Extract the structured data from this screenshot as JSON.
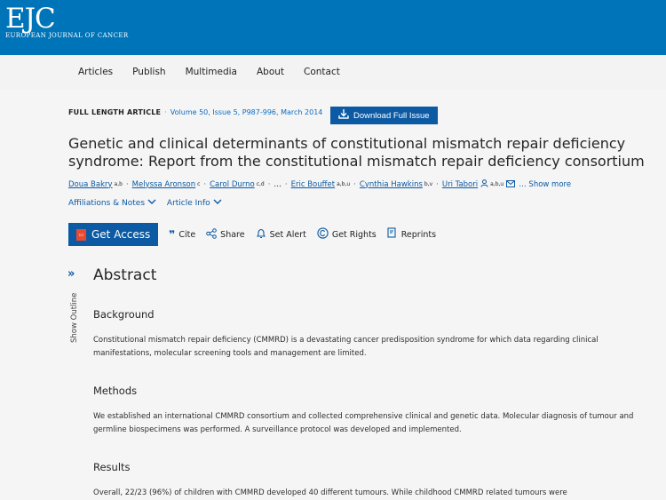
{
  "journal": {
    "logo_big": "EJC",
    "logo_small": "EUROPEAN JOURNAL OF CANCER"
  },
  "nav": {
    "items": [
      "Articles",
      "Publish",
      "Multimedia",
      "About",
      "Contact"
    ]
  },
  "article": {
    "type": "FULL LENGTH ARTICLE",
    "citation": "Volume 50, Issue 5, P987-996, March 2014",
    "download_label": "Download Full Issue",
    "title": "Genetic and clinical determinants of constitutional mismatch repair deficiency syndrome: Report from the constitutional mismatch repair deficiency consortium",
    "authors": [
      {
        "name": "Doua Bakry",
        "sup": "a,b"
      },
      {
        "name": "Melyssa Aronson",
        "sup": "c"
      },
      {
        "name": "Carol Durno",
        "sup": "c,d"
      },
      {
        "name": "Eric Bouffet",
        "sup": "a,b,u"
      },
      {
        "name": "Cynthia Hawkins",
        "sup": "b,v"
      },
      {
        "name": "Uri Tabori",
        "sup": "a,b,u"
      }
    ],
    "ellipsis": "…",
    "show_more": "… Show more",
    "affiliations_label": "Affiliations & Notes",
    "article_info_label": "Article Info",
    "actions": {
      "get_access": "Get Access",
      "cite": "Cite",
      "share": "Share",
      "set_alert": "Set Alert",
      "get_rights": "Get Rights",
      "reprints": "Reprints"
    }
  },
  "outline": {
    "label": "Show Outline"
  },
  "abstract": {
    "heading": "Abstract",
    "background_heading": "Background",
    "background_text": "Constitutional mismatch repair deficiency (CMMRD) is a devastating cancer predisposition syndrome for which data regarding clinical manifestations, molecular screening tools and management are limited.",
    "methods_heading": "Methods",
    "methods_text": "We established an international CMMRD consortium and collected comprehensive clinical and genetic data. Molecular diagnosis of tumour and germline biospecimens was performed. A surveillance protocol was developed and implemented.",
    "results_heading": "Results",
    "results_text": "Overall, 22/23 (96%) of children with CMMRD developed 40 different tumours. While childhood CMMRD related tumours were"
  },
  "colors": {
    "header_blue": "#0074b8",
    "button_blue": "#0c5aa3",
    "link_blue": "#0c6cc2",
    "pdf_red": "#e8492f"
  }
}
